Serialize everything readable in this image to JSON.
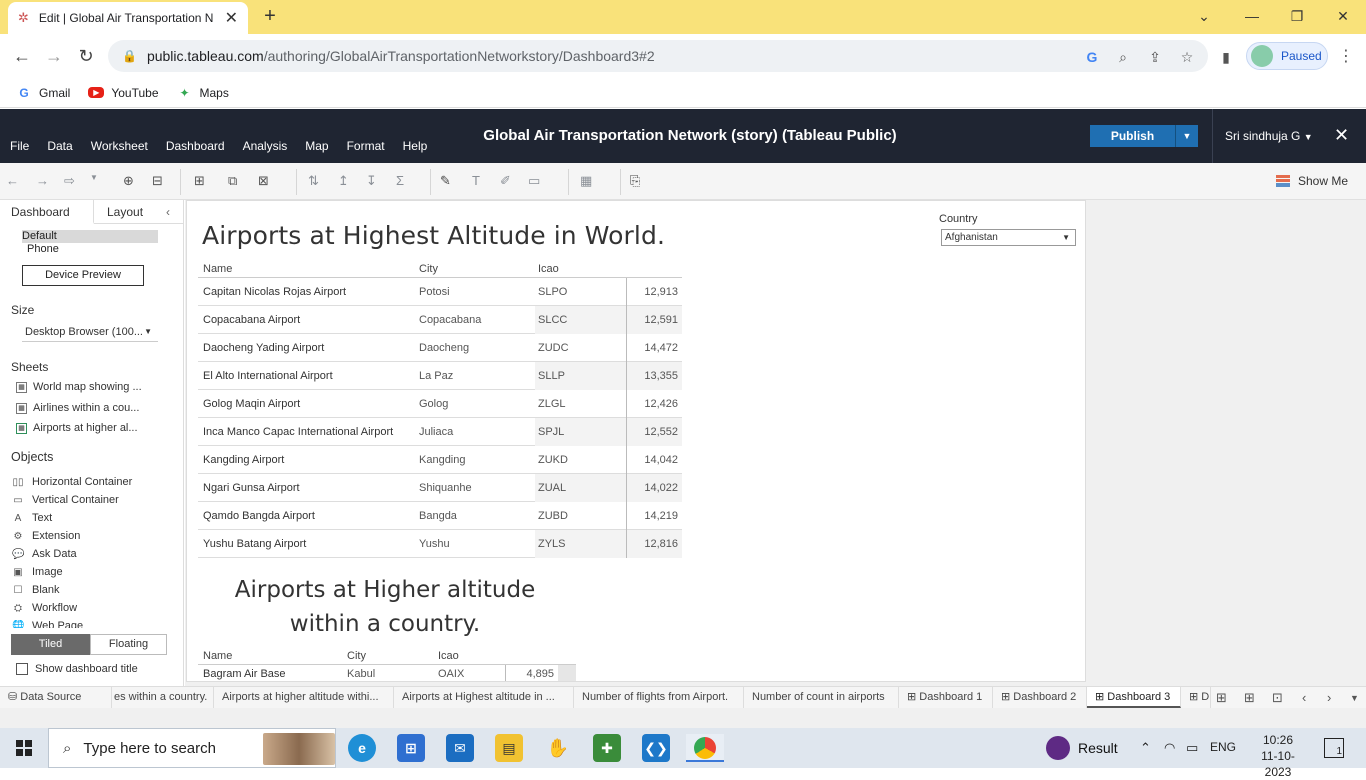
{
  "browser": {
    "tab_title": "Edit | Global Air Transportation N",
    "url_host": "public.tableau.com",
    "url_path": "/authoring/GlobalAirTransportationNetworkstory/Dashboard3#2",
    "profile_status": "Paused",
    "bookmarks": [
      "Gmail",
      "YouTube",
      "Maps"
    ]
  },
  "tableau": {
    "menus": [
      "File",
      "Data",
      "Worksheet",
      "Dashboard",
      "Analysis",
      "Map",
      "Format",
      "Help"
    ],
    "title": "Global Air Transportation Network (story) (Tableau Public)",
    "publish_label": "Publish",
    "user_name": "Sri sindhuja G",
    "show_me": "Show Me"
  },
  "left_panel": {
    "tab_dashboard": "Dashboard",
    "tab_layout": "Layout",
    "device_default": "Default",
    "device_phone": "Phone",
    "device_preview": "Device Preview",
    "size_header": "Size",
    "size_value": "Desktop Browser (100...",
    "sheets_header": "Sheets",
    "sheets": [
      "World map showing ...",
      "Airlines within a cou...",
      "Airports at higher al..."
    ],
    "objects_header": "Objects",
    "objects": [
      {
        "label": "Horizontal Container",
        "icon": "▯▯"
      },
      {
        "label": "Vertical Container",
        "icon": "▭"
      },
      {
        "label": "Text",
        "icon": "A"
      },
      {
        "label": "Extension",
        "icon": "⚙"
      },
      {
        "label": "Ask Data",
        "icon": "💬"
      },
      {
        "label": "Image",
        "icon": "▣"
      },
      {
        "label": "Blank",
        "icon": "☐"
      },
      {
        "label": "Workflow",
        "icon": "⛭"
      },
      {
        "label": "Web Page",
        "icon": "🌐"
      }
    ],
    "tiled": "Tiled",
    "floating": "Floating",
    "show_title": "Show dashboard title"
  },
  "dashboard": {
    "title1": "Airports at Highest Altitude in World.",
    "col_name": "Name",
    "col_city": "City",
    "col_icao": "Icao",
    "rows": [
      {
        "name": "Capitan Nicolas Rojas Airport",
        "city": "Potosi",
        "icao": "SLPO",
        "alt": "12,913"
      },
      {
        "name": "Copacabana Airport",
        "city": "Copacabana",
        "icao": "SLCC",
        "alt": "12,591"
      },
      {
        "name": "Daocheng Yading Airport",
        "city": "Daocheng",
        "icao": "ZUDC",
        "alt": "14,472"
      },
      {
        "name": "El Alto International Airport",
        "city": "La Paz",
        "icao": "SLLP",
        "alt": "13,355"
      },
      {
        "name": "Golog Maqin Airport",
        "city": "Golog",
        "icao": "ZLGL",
        "alt": "12,426"
      },
      {
        "name": "Inca Manco Capac International Airport",
        "city": "Juliaca",
        "icao": "SPJL",
        "alt": "12,552"
      },
      {
        "name": "Kangding Airport",
        "city": "Kangding",
        "icao": "ZUKD",
        "alt": "14,042"
      },
      {
        "name": "Ngari Gunsa Airport",
        "city": "Shiquanhe",
        "icao": "ZUAL",
        "alt": "14,022"
      },
      {
        "name": "Qamdo Bangda Airport",
        "city": "Bangda",
        "icao": "ZUBD",
        "alt": "14,219"
      },
      {
        "name": "Yushu Batang Airport",
        "city": "Yushu",
        "icao": "ZYLS",
        "alt": "12,816"
      }
    ],
    "title2_line1": "Airports at Higher altitude",
    "title2_line2": "within a country.",
    "table2_row": {
      "name": "Bagram Air Base",
      "city": "Kabul",
      "icao": "OAIX",
      "alt": "4,895"
    },
    "country_label": "Country",
    "country_value": "Afghanistan"
  },
  "sheet_tabs": [
    "Data Source",
    "es within a country.",
    "Airports at higher altitude withi...",
    "Airports at Highest altitude in ...",
    "Number of flights from Airport.",
    "Number of count in airports",
    "Dashboard 1",
    "Dashboard 2",
    "Dashboard 3",
    "D"
  ],
  "taskbar": {
    "search_placeholder": "Type here to search",
    "result_label": "Result",
    "lang": "ENG",
    "time": "10:26",
    "date": "11-10-2023",
    "notif_count": "1"
  }
}
